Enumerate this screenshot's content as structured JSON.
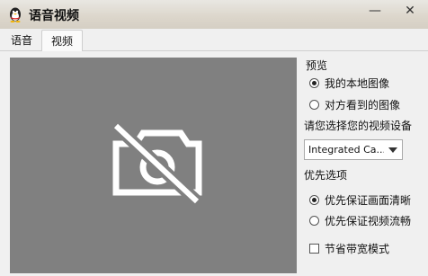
{
  "window": {
    "title": "语音视频",
    "minimize_glyph": "—",
    "close_glyph": "✕"
  },
  "tabs": [
    {
      "label": "语音"
    },
    {
      "label": "视频",
      "selected": true
    }
  ],
  "preview_panel": {
    "status_icon": "camera-off-icon",
    "background": "#808080"
  },
  "sidebar": {
    "preview_label": "预览",
    "preview_options": [
      {
        "label": "我的本地图像",
        "checked": true
      },
      {
        "label": "对方看到的图像",
        "checked": false
      }
    ],
    "device_label": "请您选择您的视频设备",
    "device_select": {
      "value": "Integrated Ca..."
    },
    "priority_label": "优先选项",
    "priority_options": [
      {
        "label": "优先保证画面清晰",
        "checked": true
      },
      {
        "label": "优先保证视频流畅",
        "checked": false
      }
    ],
    "bandwidth_saving": {
      "label": "节省带宽模式",
      "checked": false
    }
  }
}
